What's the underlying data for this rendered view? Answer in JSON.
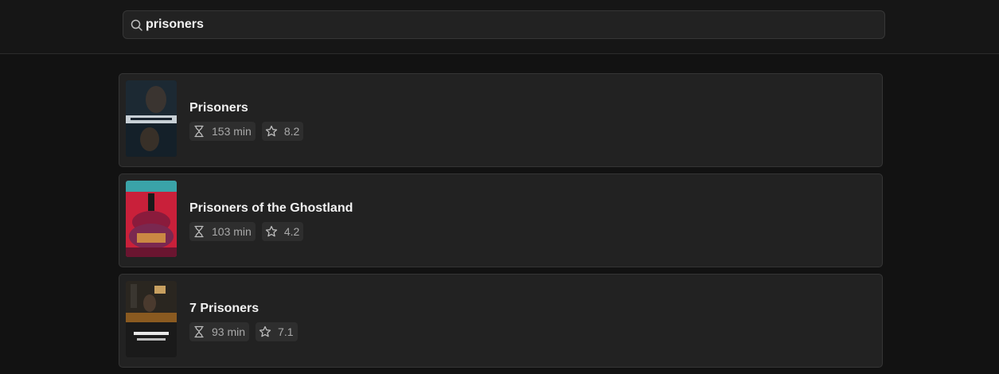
{
  "search": {
    "value": "prisoners",
    "icon": "search-icon"
  },
  "results": [
    {
      "title": "Prisoners",
      "runtime": "153 min",
      "rating": "8.2",
      "poster": "prisoners-poster"
    },
    {
      "title": "Prisoners of the Ghostland",
      "runtime": "103 min",
      "rating": "4.2",
      "poster": "prisoners-of-the-ghostland-poster"
    },
    {
      "title": "7 Prisoners",
      "runtime": "93 min",
      "rating": "7.1",
      "poster": "7-prisoners-poster"
    }
  ],
  "icons": {
    "runtime": "hourglass-icon",
    "rating": "star-icon"
  },
  "colors": {
    "background": "#121212",
    "card": "#222222",
    "chip": "#2e2e2e",
    "text": "#f1f1f1",
    "muted": "#a9a9a9"
  }
}
